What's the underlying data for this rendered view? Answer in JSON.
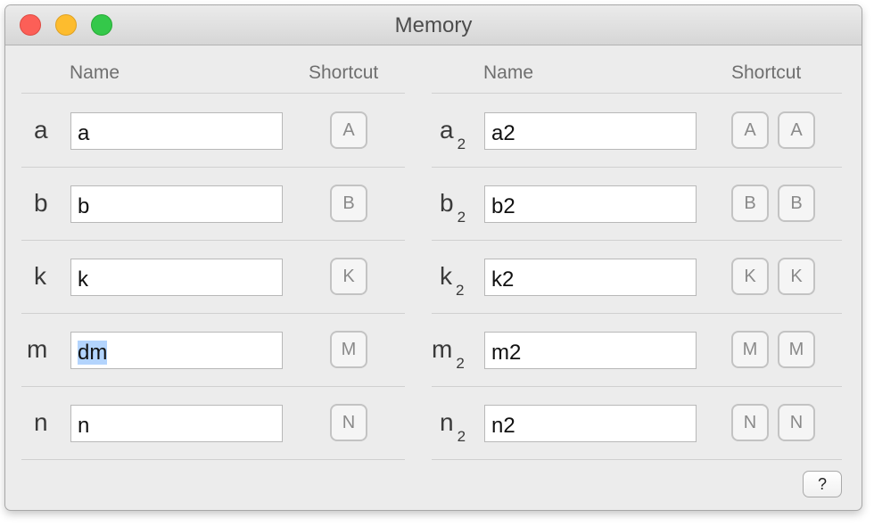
{
  "window": {
    "title": "Memory"
  },
  "headers": {
    "left_name": "Name",
    "left_shortcut": "Shortcut",
    "right_name": "Name",
    "right_shortcut": "Shortcut"
  },
  "left_rows": [
    {
      "label": "a",
      "value": "a",
      "key": "A"
    },
    {
      "label": "b",
      "value": "b",
      "key": "B"
    },
    {
      "label": "k",
      "value": "k",
      "key": "K"
    },
    {
      "label": "m",
      "value": "dm",
      "key": "M",
      "selected": true
    },
    {
      "label": "n",
      "value": "n",
      "key": "N"
    }
  ],
  "right_rows": [
    {
      "label": "a",
      "subscript": "2",
      "value": "a2",
      "key1": "A",
      "key2": "A"
    },
    {
      "label": "b",
      "subscript": "2",
      "value": "b2",
      "key1": "B",
      "key2": "B"
    },
    {
      "label": "k",
      "subscript": "2",
      "value": "k2",
      "key1": "K",
      "key2": "K"
    },
    {
      "label": "m",
      "subscript": "2",
      "value": "m2",
      "key1": "M",
      "key2": "M"
    },
    {
      "label": "n",
      "subscript": "2",
      "value": "n2",
      "key1": "N",
      "key2": "N"
    }
  ],
  "help_button": "?",
  "colors": {
    "selection": "#b3d4fd",
    "close": "#fc5f57",
    "minimize": "#fdbc2e",
    "zoom": "#34c84a"
  }
}
